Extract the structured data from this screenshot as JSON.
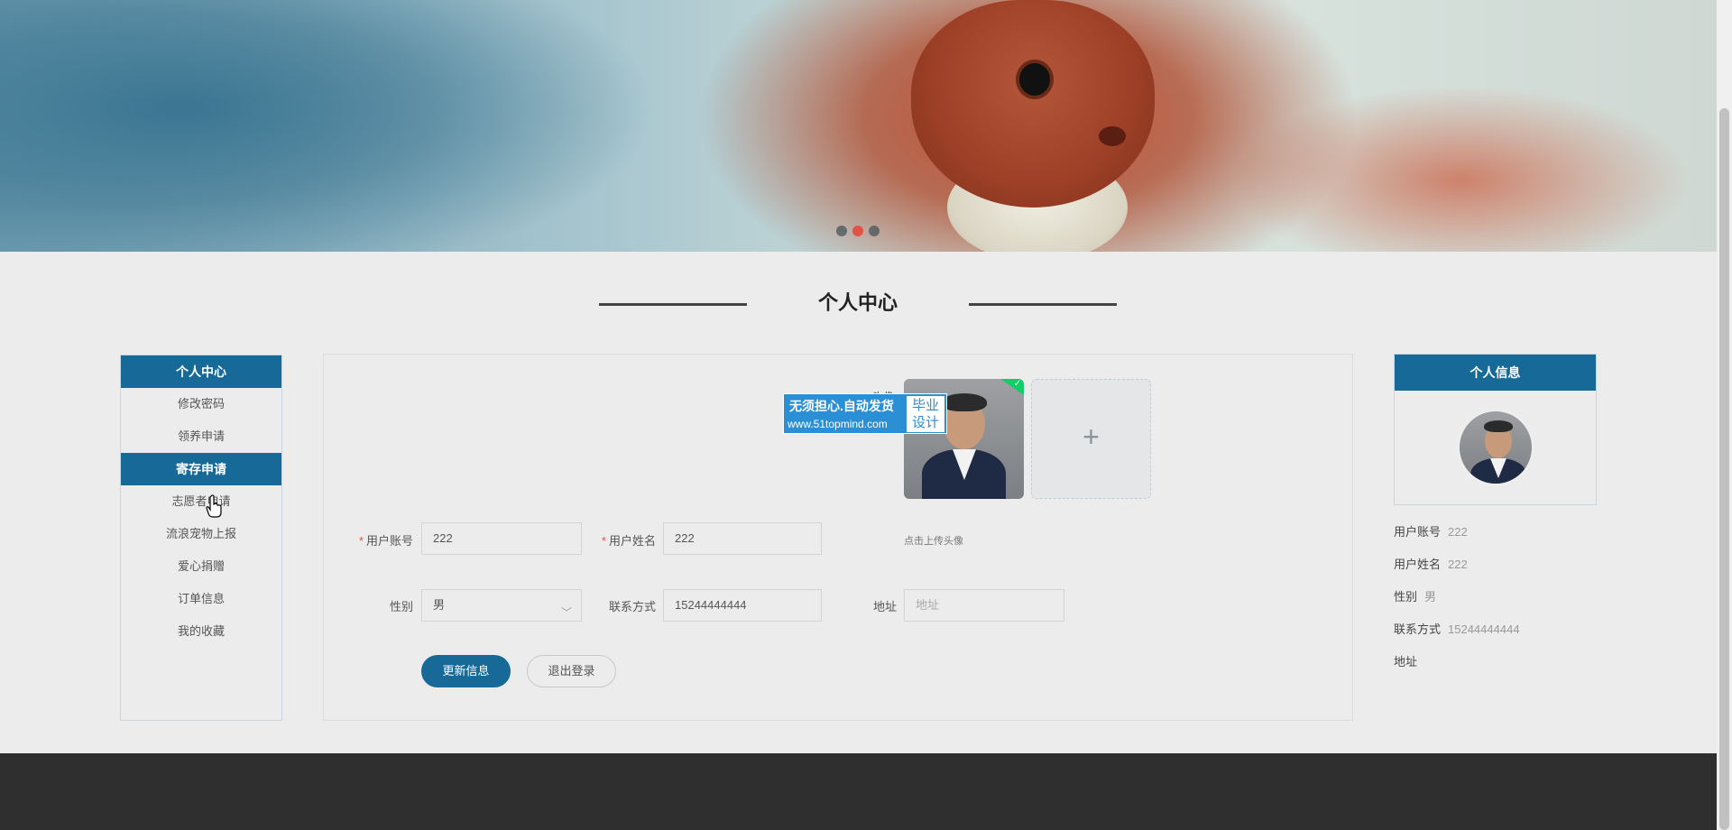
{
  "page_title": "个人中心",
  "banner": {
    "dots": 3,
    "active_dot": 2
  },
  "menu": {
    "items": [
      {
        "label": "个人中心",
        "active": true
      },
      {
        "label": "修改密码",
        "active": false
      },
      {
        "label": "领养申请",
        "active": false
      },
      {
        "label": "寄存申请",
        "active": true
      },
      {
        "label": "志愿者申请",
        "active": false
      },
      {
        "label": "流浪宠物上报",
        "active": false
      },
      {
        "label": "爱心捐赠",
        "active": false
      },
      {
        "label": "订单信息",
        "active": false
      },
      {
        "label": "我的收藏",
        "active": false
      }
    ]
  },
  "form": {
    "avatar_label": "头像",
    "upload_plus": "+",
    "upload_tip": "点击上传头像",
    "account_label": "用户账号",
    "account_value": "222",
    "name_label": "用户姓名",
    "name_value": "222",
    "gender_label": "性别",
    "gender_value": "男",
    "phone_label": "联系方式",
    "phone_value": "15244444444",
    "address_label": "地址",
    "address_placeholder": "地址",
    "required_mark": "*",
    "update_button": "更新信息",
    "logout_button": "退出登录"
  },
  "watermark": {
    "main": "无须担心.自动发货",
    "url": "www.51topmind.com",
    "side_line1": "毕业",
    "side_line2": "设计"
  },
  "profile": {
    "header": "个人信息",
    "rows": [
      {
        "label": "用户账号",
        "value": "222"
      },
      {
        "label": "用户姓名",
        "value": "222"
      },
      {
        "label": "性别",
        "value": "男"
      },
      {
        "label": "联系方式",
        "value": "15244444444"
      },
      {
        "label": "地址",
        "value": ""
      }
    ]
  },
  "colors": {
    "primary": "#176a98",
    "accent": "#e25244",
    "footer": "#2f2f2f"
  }
}
